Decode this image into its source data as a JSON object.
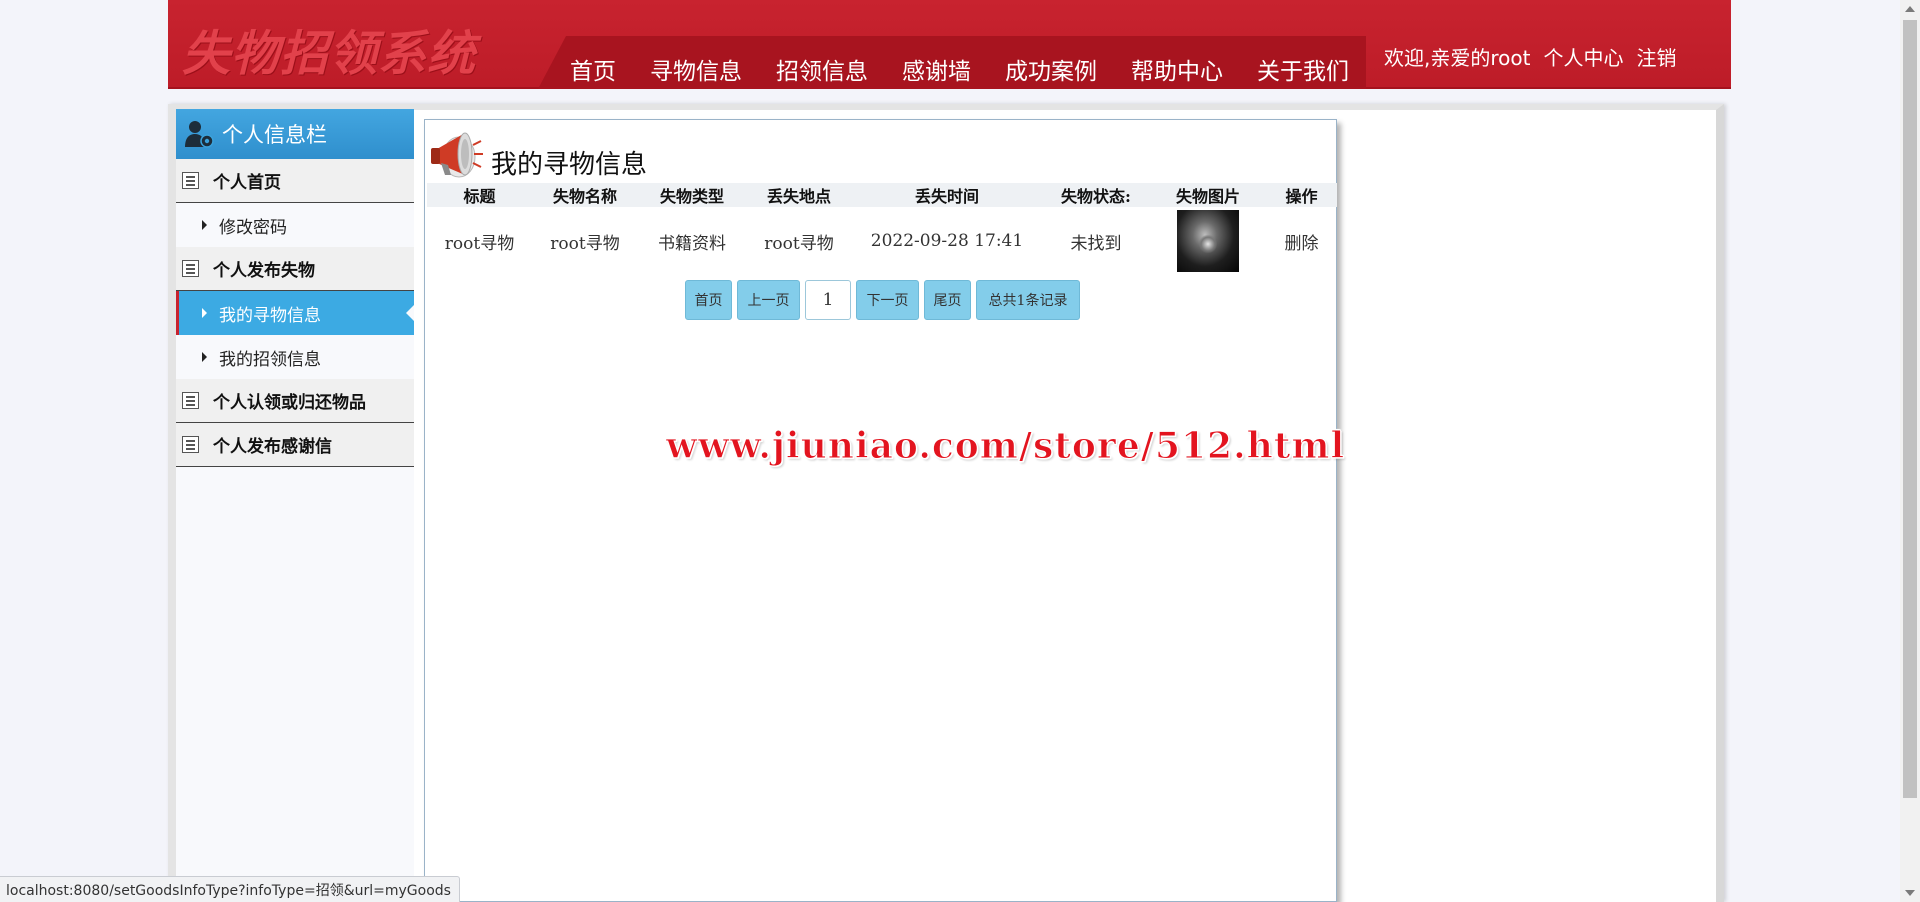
{
  "header": {
    "logo": "失物招领系统",
    "nav": [
      "首页",
      "寻物信息",
      "招领信息",
      "感谢墙",
      "成功案例",
      "帮助中心",
      "关于我们"
    ],
    "welcome": "欢迎,亲爱的root",
    "user_center": "个人中心",
    "logout": "注销"
  },
  "sidebar": {
    "title": "个人信息栏",
    "sections": [
      {
        "label": "个人首页",
        "items": [
          "修改密码"
        ]
      },
      {
        "label": "个人发布失物",
        "items": [
          "我的寻物信息",
          "我的招领信息"
        ]
      },
      {
        "label": "个人认领或归还物品",
        "items": []
      },
      {
        "label": "个人发布感谢信",
        "items": []
      }
    ],
    "active_item": "我的寻物信息"
  },
  "main": {
    "title": "我的寻物信息",
    "columns": [
      "标题",
      "失物名称",
      "失物类型",
      "丢失地点",
      "丢失时间",
      "失物状态:",
      "失物图片",
      "操作"
    ],
    "rows": [
      {
        "title": "root寻物",
        "name": "root寻物",
        "type": "书籍资料",
        "location": "root寻物",
        "time": "2022-09-28 17:41",
        "status": "未找到",
        "image": "photo",
        "action": "删除"
      }
    ],
    "pager": {
      "first": "首页",
      "prev": "上一页",
      "page": "1",
      "next": "下一页",
      "last": "尾页",
      "total": "总共1条记录"
    }
  },
  "watermark": "www.jiuniao.com/store/512.html",
  "statusbar": "localhost:8080/setGoodsInfoType?infoType=招领&url=myGoods",
  "colors": {
    "header_red": "#c8232f",
    "nav_band": "#a8141f",
    "sidebar_blue": "#3caae3",
    "pager_blue": "#83cdea"
  }
}
